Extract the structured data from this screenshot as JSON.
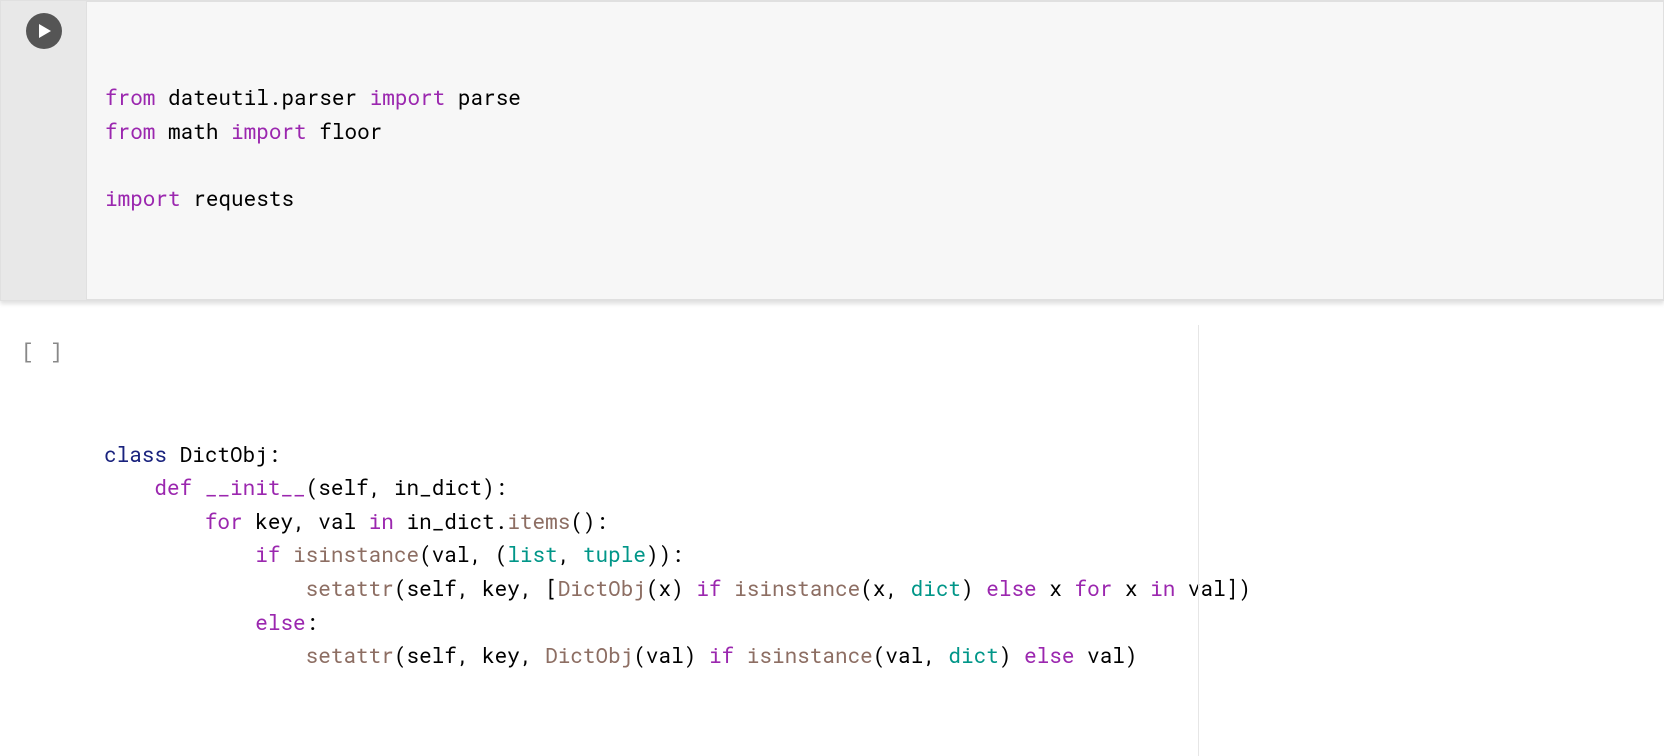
{
  "cells": [
    {
      "state": "active",
      "exec_label": "",
      "code_html": "<span class=\"kw\">from</span> dateutil.parser <span class=\"kw\">import</span> parse\n<span class=\"kw\">from</span> math <span class=\"kw\">import</span> floor\n\n<span class=\"kw\">import</span> requests"
    },
    {
      "state": "inactive",
      "exec_label": "[ ]",
      "code_html": "<span class=\"kw2\">class</span> <span class=\"pl\">DictObj</span>:\n    <span class=\"kw\">def</span> <span class=\"dund\">__init__</span>(self, in_dict):\n        <span class=\"kw\">for</span> key, val <span class=\"kw\">in</span> in_dict.<span class=\"fn\">items</span>():\n            <span class=\"kw\">if</span> <span class=\"fn\">isinstance</span>(val, (<span class=\"ty\">list</span>, <span class=\"ty\">tuple</span>)):\n                <span class=\"fn\">setattr</span>(self, key, [<span class=\"fn\">DictObj</span>(x) <span class=\"kw\">if</span> <span class=\"fn\">isinstance</span>(x, <span class=\"ty\">dict</span>) <span class=\"kw\">else</span> x <span class=\"kw\">for</span> x <span class=\"kw\">in</span> val])\n            <span class=\"kw\">else</span>:\n                <span class=\"fn\">setattr</span>(self, key, <span class=\"fn\">DictObj</span>(val) <span class=\"kw\">if</span> <span class=\"fn\">isinstance</span>(val, <span class=\"ty\">dict</span>) <span class=\"kw\">else</span> val)\n"
    }
  ]
}
